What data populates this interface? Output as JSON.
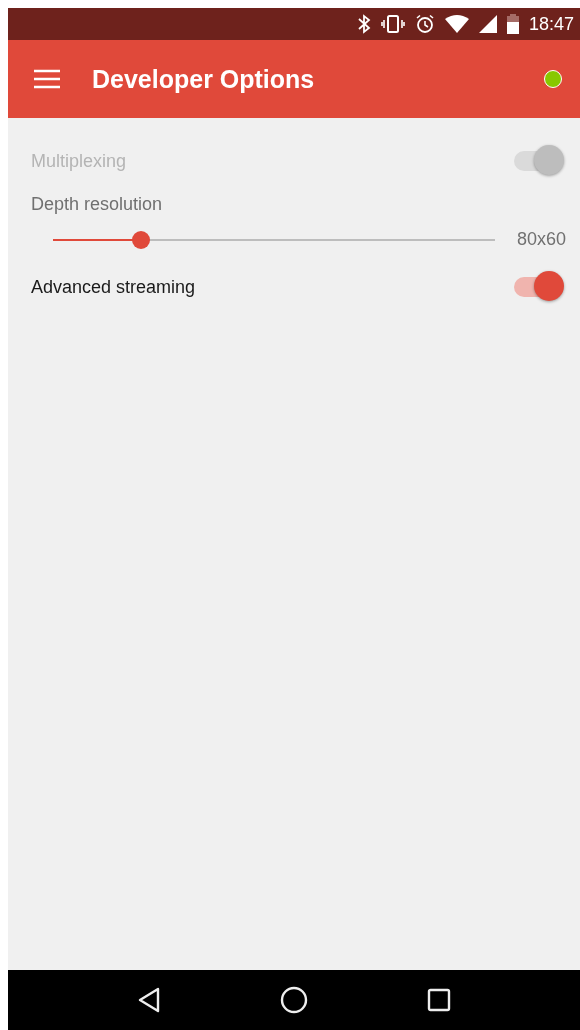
{
  "status_bar": {
    "time": "18:47"
  },
  "app_bar": {
    "title": "Developer Options",
    "status_dot": {
      "on": true
    }
  },
  "settings": [
    {
      "kind": "switch",
      "label": "Multiplexing",
      "on": true,
      "disabled": true
    },
    {
      "kind": "slider",
      "label": "Depth resolution",
      "level": 0.2,
      "reading": "80x60",
      "disabled": false
    },
    {
      "kind": "switch",
      "label": "Advanced streaming",
      "on": true,
      "disabled": false
    }
  ]
}
